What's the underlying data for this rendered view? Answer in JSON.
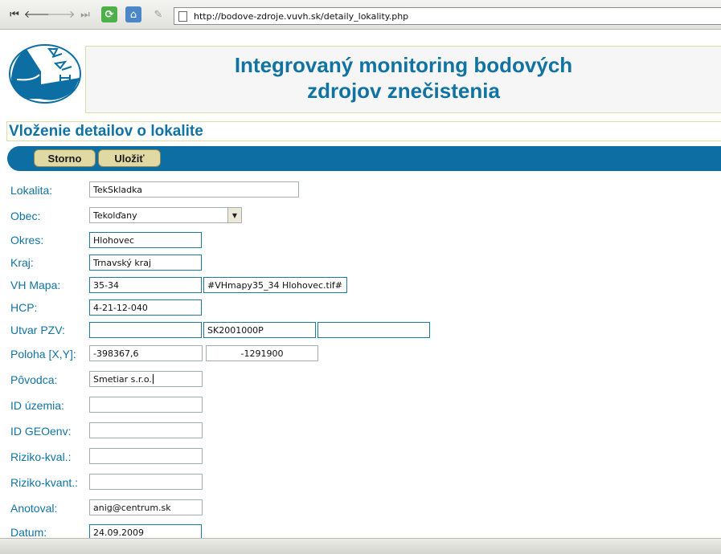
{
  "browser": {
    "url": "http://bodove-zdroje.vuvh.sk/detaily_lokality.php"
  },
  "header": {
    "title_line1": "Integrovaný monitoring bodových",
    "title_line2": "zdrojov znečistenia"
  },
  "section": {
    "title": "Vloženie detailov o lokalite"
  },
  "actions": {
    "cancel_label": "Storno",
    "save_label": "Uložiť"
  },
  "form": {
    "lokalita_label": "Lokalita:",
    "lokalita_value": "TekSkladka",
    "obec_label": "Obec:",
    "obec_value": "Tekolďany",
    "okres_label": "Okres:",
    "okres_value": "Hlohovec",
    "kraj_label": "Kraj:",
    "kraj_value": "Trnavský kraj",
    "vhmapa_label": "VH Mapa:",
    "vhmapa_value": "35-34",
    "vhmapa_file": "#VHmapy35_34 Hlohovec.tif#",
    "hcp_label": "HCP:",
    "hcp_value": "4-21-12-040",
    "utvar_label": "Utvar PZV:",
    "utvar_value1": "",
    "utvar_value2": "SK2001000P",
    "utvar_value3": "",
    "poloha_label": "Poloha [X,Y]:",
    "poloha_x": "-398367,6",
    "poloha_y": "-1291900",
    "povodca_label": "Pôvodca:",
    "povodca_value": "Smetiar s.r.o.",
    "id_uzemia_label": "ID územia:",
    "id_uzemia_value": "",
    "id_geoenv_label": "ID GEOenv:",
    "id_geoenv_value": "",
    "riziko_kval_label": "Riziko-kval.:",
    "riziko_kval_value": "",
    "riziko_kvant_label": "Riziko-kvant.:",
    "riziko_kvant_value": "",
    "anotoval_label": "Anotoval:",
    "anotoval_value": "anig@centrum.sk",
    "datum_label": "Datum:",
    "datum_value": "24.09.2009"
  },
  "colors": {
    "brand_blue": "#1173a2",
    "action_bar": "#0c6ea3",
    "button_bg": "#e0d9a4"
  },
  "icons": [
    "back-to-start-icon",
    "back-icon",
    "forward-icon",
    "forward-to-end-icon",
    "reload-icon",
    "home-icon",
    "edit-pencil-icon",
    "page-icon"
  ]
}
